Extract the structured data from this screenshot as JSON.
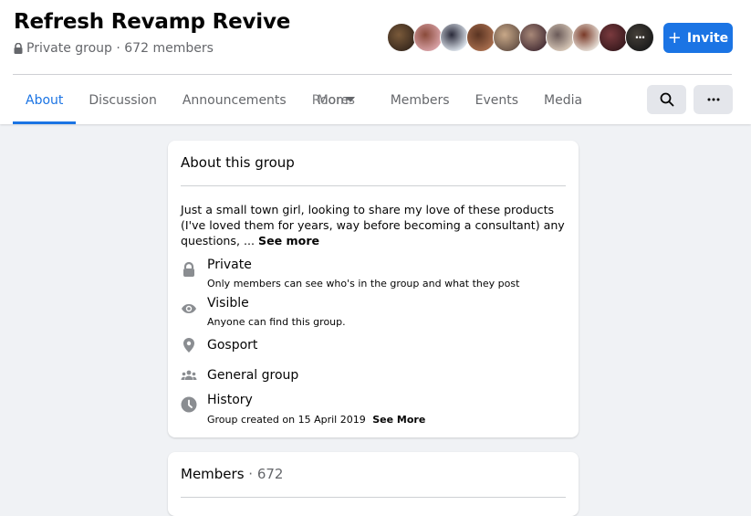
{
  "header": {
    "title": "Refresh Revamp Revive",
    "privacy_icon": "lock-icon",
    "subtitle": "Private group · 672 members",
    "invite_label": "Invite",
    "invite_icon": "plus-icon",
    "accent_color": "#1b74e4",
    "member_avatars": [
      {
        "name": "member-avatar-1",
        "colors": [
          "#3a2a1e",
          "#7a5a3a"
        ]
      },
      {
        "name": "member-avatar-2",
        "colors": [
          "#d9a3a8",
          "#8a4a3a"
        ]
      },
      {
        "name": "member-avatar-3",
        "colors": [
          "#dfe6ee",
          "#2a2a3a"
        ]
      },
      {
        "name": "member-avatar-4",
        "colors": [
          "#a86e4e",
          "#5a3422"
        ]
      },
      {
        "name": "member-avatar-5",
        "colors": [
          "#6a5548",
          "#c8a888"
        ]
      },
      {
        "name": "member-avatar-6",
        "colors": [
          "#4a3238",
          "#a88878"
        ]
      },
      {
        "name": "member-avatar-7",
        "colors": [
          "#d8c8b8",
          "#6a5a58"
        ]
      },
      {
        "name": "member-avatar-8",
        "colors": [
          "#e8e2da",
          "#7a3a28"
        ]
      },
      {
        "name": "member-avatar-9",
        "colors": [
          "#3a1a1e",
          "#7a3a3e"
        ]
      },
      {
        "name": "member-avatar-10",
        "colors": [
          "#2a2a2a",
          "#6a6258"
        ],
        "more": "···"
      }
    ]
  },
  "tabs": [
    {
      "label": "About",
      "active": true
    },
    {
      "label": "Discussion"
    },
    {
      "label": "Announcements"
    },
    {
      "label": "Rooms",
      "overlap_label": "More"
    },
    {
      "label": "Members"
    },
    {
      "label": "Events"
    },
    {
      "label": "Media"
    }
  ],
  "toolbar": {
    "search_icon": "search-icon",
    "more_icon": "more-options-icon"
  },
  "about": {
    "title": "About this group",
    "description": "Just a small town girl, looking to share my love of these products (I've loved them for years, way before becoming a consultant) any questions, ...",
    "see_more": "See more",
    "items": [
      {
        "icon": "lock-icon",
        "title": "Private",
        "subtitle": "Only members can see who's in the group and what they post"
      },
      {
        "icon": "eye-icon",
        "title": "Visible",
        "subtitle": "Anyone can find this group."
      },
      {
        "icon": "location-pin-icon",
        "title": "Gosport"
      },
      {
        "icon": "people-icon",
        "title": "General group"
      },
      {
        "icon": "clock-icon",
        "title": "History",
        "subtitle": "Group created on 15 April 2019",
        "link": "See More"
      }
    ]
  },
  "members": {
    "title": "Members",
    "separator": " · ",
    "count": "672"
  }
}
